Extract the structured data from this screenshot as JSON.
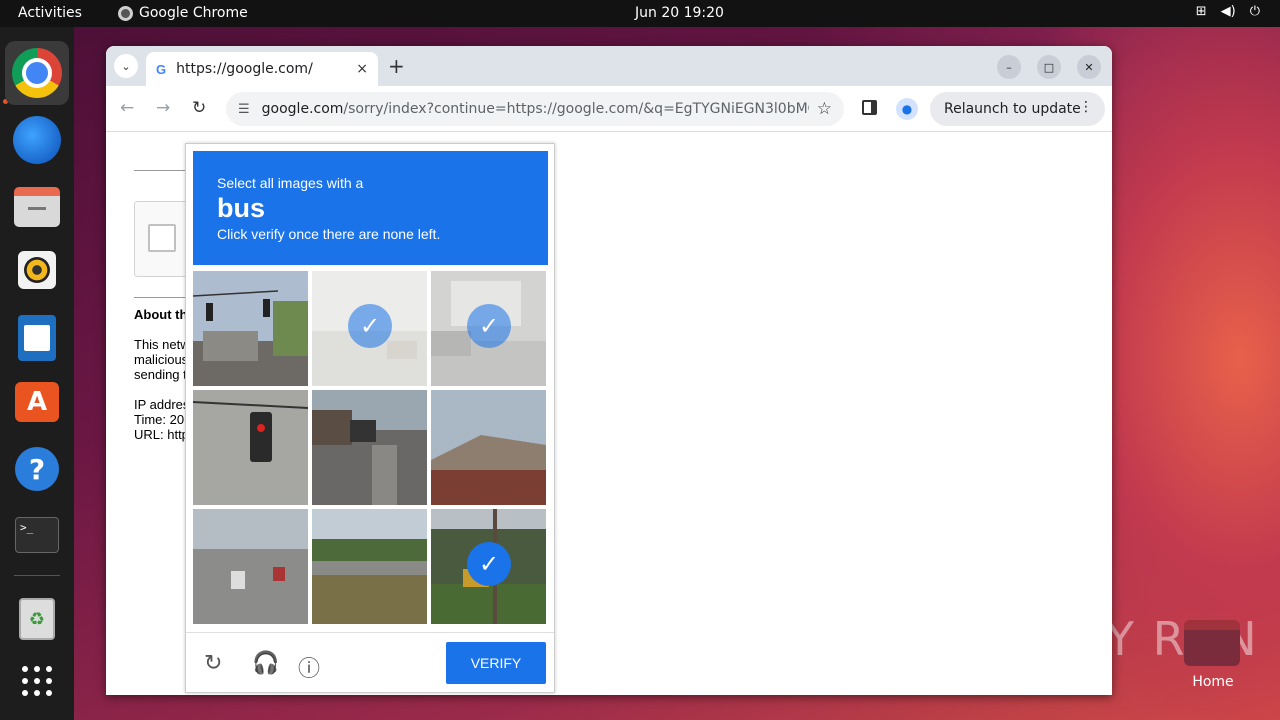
{
  "topbar": {
    "activities": "Activities",
    "app_name": "Google Chrome",
    "clock": "Jun 20  19:20"
  },
  "dock": {
    "items": [
      "chrome-icon",
      "thunderbird-icon",
      "files-icon",
      "rhythmbox-icon",
      "writer-icon",
      "app-center-icon",
      "help-icon",
      "terminal-icon",
      "trash-icon",
      "show-apps-icon"
    ]
  },
  "desktop": {
    "home_label": "Home",
    "watermark": "ANY RUN"
  },
  "browser": {
    "tab_title": "https://google.com/",
    "tab_close": "×",
    "new_tab": "+",
    "url_domain": "google.com",
    "url_path": "/sorry/index?continue=https://google.com/&q=EgTYGNiEGN3l0bMGIjA0...",
    "relaunch": "Relaunch to update"
  },
  "page": {
    "about": "About th",
    "para1": [
      "This netw",
      "malicious",
      "sending t"
    ],
    "para2": [
      "IP addres",
      "Time: 20",
      "URL: http"
    ]
  },
  "captcha": {
    "line1": "Select all images with a",
    "keyword": "bus",
    "line3": "Click verify once there are none left.",
    "verify": "VERIFY",
    "tiles": [
      {
        "label": "traffic-light-street",
        "selected": false
      },
      {
        "label": "faded-road",
        "selected": true
      },
      {
        "label": "bus-on-road",
        "selected": true
      },
      {
        "label": "traffic-light-closeup",
        "selected": false
      },
      {
        "label": "street-with-cars",
        "selected": false
      },
      {
        "label": "house-roof",
        "selected": false
      },
      {
        "label": "highway-cars",
        "selected": false
      },
      {
        "label": "grass-road",
        "selected": false
      },
      {
        "label": "bus-near-trees",
        "selected": true
      }
    ]
  },
  "colors": {
    "captcha_blue": "#1a73e8",
    "ubuntu_orange": "#e95420"
  }
}
